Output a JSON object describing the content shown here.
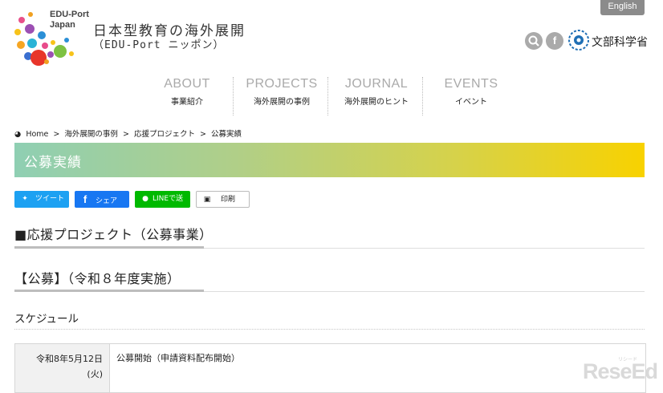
{
  "header": {
    "logo_text": "EDU-Port\nJapan",
    "site_title": "日本型教育の海外展開",
    "site_subtitle": "（EDU-Port ニッポン）",
    "english_button": "English",
    "ministry_name": "文部科学省"
  },
  "nav": {
    "items": [
      {
        "en": "ABOUT",
        "jp": "事業紹介"
      },
      {
        "en": "PROJECTS",
        "jp": "海外展開の事例"
      },
      {
        "en": "JOURNAL",
        "jp": "海外展開のヒント"
      },
      {
        "en": "EVENTS",
        "jp": "イベント"
      }
    ]
  },
  "breadcrumb": {
    "home": "Home",
    "sep": ">",
    "items": [
      "海外展開の事例",
      "応援プロジェクト",
      "公募実績"
    ]
  },
  "banner": {
    "title": "公募実績"
  },
  "share": {
    "tweet": "ツイート",
    "facebook": "シェア",
    "line": "LINEで送る",
    "print": "印刷"
  },
  "content": {
    "heading_main": "■応援プロジェクト（公募事業）",
    "heading_sub": "【公募】（令和８年度実施）",
    "heading_schedule": "スケジュール",
    "schedule": [
      {
        "date_line1": "令和8年5月12日",
        "date_line2": "(火)",
        "description": "公募開始（申請資料配布開始）"
      }
    ]
  },
  "watermark": {
    "text": "ReseEd",
    "small": "リシード"
  },
  "colors": {
    "banner_start": "#8fcfb3",
    "banner_end": "#f8d200",
    "twitter": "#1da1f2",
    "facebook": "#1877f2",
    "line": "#00b900"
  }
}
